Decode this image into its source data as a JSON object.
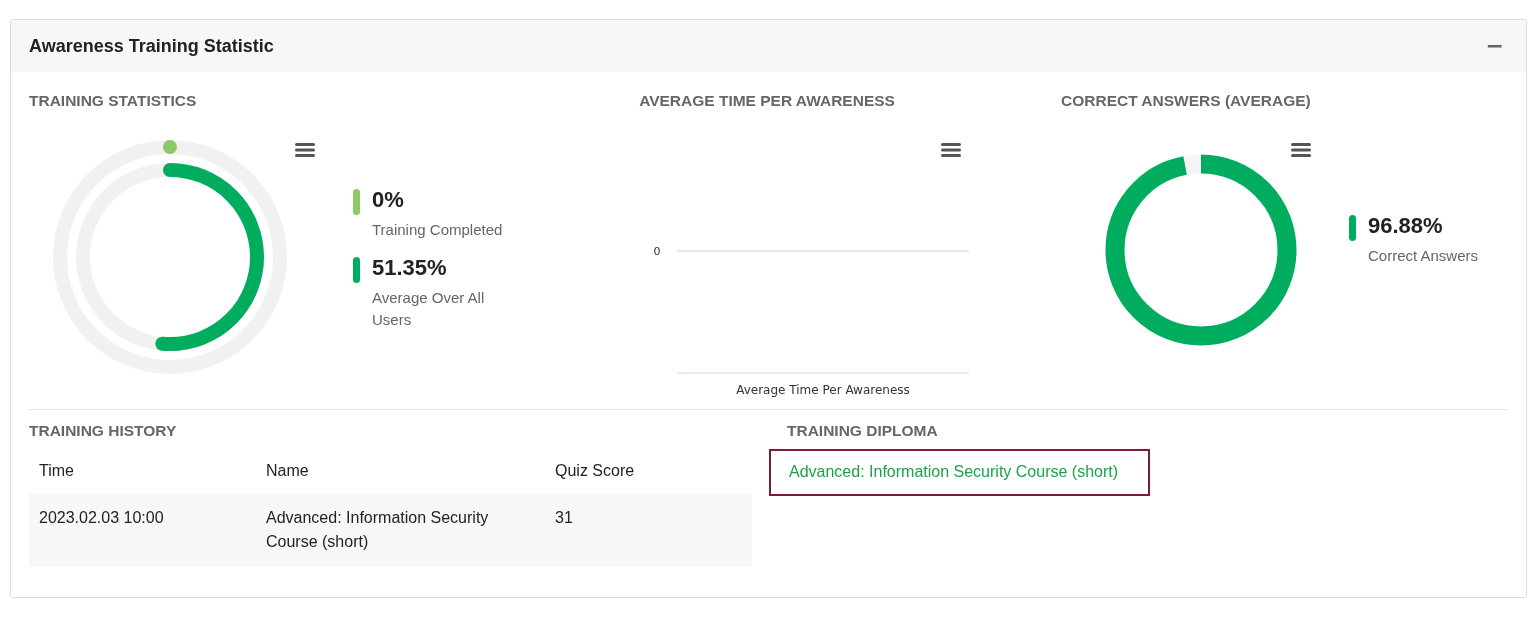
{
  "panel": {
    "title": "Awareness Training Statistic",
    "collapse_icon": "−"
  },
  "training_statistics": {
    "title": "TRAINING STATISTICS",
    "legend": [
      {
        "value": "0%",
        "label": "Training Completed",
        "level": 0,
        "color": "#8cc96a"
      },
      {
        "value": "51.35%",
        "label": "Average Over All Users",
        "level": 0.5135,
        "color": "#00ad5f"
      }
    ]
  },
  "average_time": {
    "title": "AVERAGE TIME PER AWARENESS",
    "axis_value": "0",
    "axis_caption": "Average Time Per Awareness"
  },
  "correct_answers": {
    "title": "CORRECT ANSWERS (AVERAGE)",
    "legend": [
      {
        "value": "96.88%",
        "label": "Correct Answers",
        "level": 0.9688,
        "color": "#00ad5f"
      }
    ]
  },
  "training_history": {
    "title": "TRAINING HISTORY",
    "columns": [
      "Time",
      "Name",
      "Quiz Score"
    ],
    "rows": [
      [
        "2023.02.03 10:00",
        "Advanced: Information Security Course (short)",
        "31"
      ]
    ]
  },
  "training_diploma": {
    "title": "TRAINING DIPLOMA",
    "links": [
      "Advanced: Information Security Course (short)"
    ]
  }
}
